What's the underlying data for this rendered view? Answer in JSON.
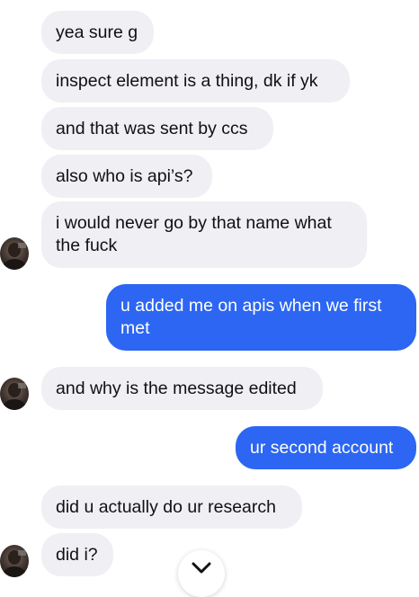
{
  "messages": [
    {
      "text": "yea sure g",
      "dir": "in"
    },
    {
      "text": "inspect element is a thing, dk if yk",
      "dir": "in"
    },
    {
      "text": "and that was sent by ccs",
      "dir": "in"
    },
    {
      "text": "also who is api’s?",
      "dir": "in"
    },
    {
      "text": "i would never go by that name what the fuck",
      "dir": "in"
    },
    {
      "text": "u added me on apis when we first met",
      "dir": "out"
    },
    {
      "text": "and why is the message edited",
      "dir": "in"
    },
    {
      "text": "ur second account",
      "dir": "out"
    },
    {
      "text": "did u actually do ur research",
      "dir": "in"
    },
    {
      "text": "did i?",
      "dir": "in"
    }
  ],
  "icons": {
    "scroll_down": "chevron-down-icon",
    "avatar": "contact-avatar"
  },
  "colors": {
    "incoming_bubble": "#efeff4",
    "outgoing_bubble": "#2c66f2",
    "incoming_text": "#111111",
    "outgoing_text": "#ffffff"
  }
}
